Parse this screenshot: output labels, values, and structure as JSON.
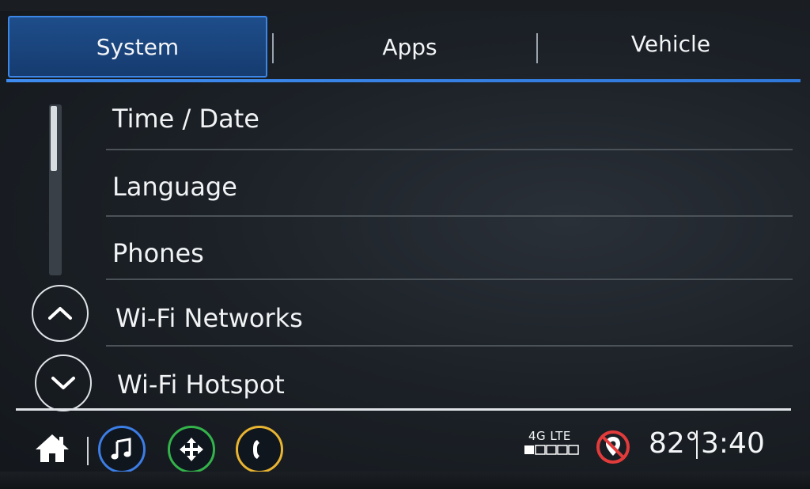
{
  "tabs": [
    {
      "label": "System",
      "selected": true
    },
    {
      "label": "Apps",
      "selected": false
    },
    {
      "label": "Vehicle",
      "selected": false
    }
  ],
  "menu": {
    "items": [
      {
        "label": "Time / Date"
      },
      {
        "label": "Language"
      },
      {
        "label": "Phones"
      },
      {
        "label": "Wi-Fi Networks"
      },
      {
        "label": "Wi-Fi Hotspot"
      }
    ]
  },
  "scroll": {
    "up_icon": "chevron-up-icon",
    "down_icon": "chevron-down-icon",
    "position_fraction": 0.0
  },
  "bottom_bar": {
    "icons": [
      "home-icon",
      "music-note-icon",
      "navigation-icon",
      "phone-icon"
    ],
    "icon_colors": {
      "music": "#3c7de6",
      "navigation": "#33b34a",
      "phone": "#e8b431"
    },
    "network": "4G LTE",
    "signal_bars_filled": 1,
    "signal_bars_total": 5,
    "location_status_icon": "location-off-icon",
    "temperature": "82°",
    "time": "3:40"
  },
  "colors": {
    "accent": "#3b86e6",
    "tab_selected_bg": "#1e4d8a",
    "text": "#f1f3f5",
    "location_off": "#e23b3b"
  }
}
